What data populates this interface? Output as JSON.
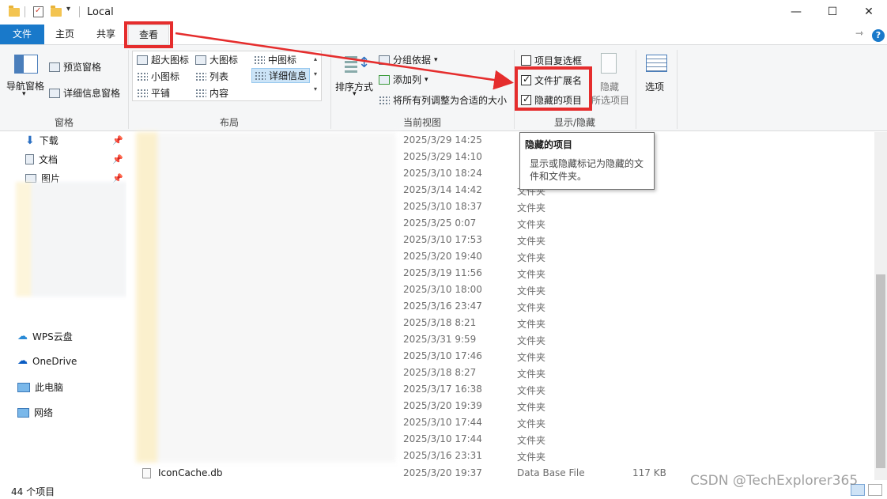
{
  "window": {
    "title": "Local"
  },
  "tabs": {
    "file": "文件",
    "home": "主页",
    "share": "共享",
    "view": "查看"
  },
  "ribbon": {
    "panes": {
      "nav": "导航窗格",
      "preview": "预览窗格",
      "details": "详细信息窗格",
      "group": "窗格"
    },
    "layout": {
      "xl": "超大图标",
      "large": "大图标",
      "medium": "中图标",
      "small": "小图标",
      "list": "列表",
      "details": "详细信息",
      "tiles": "平铺",
      "content": "内容",
      "group": "布局"
    },
    "current_view": {
      "sort": "排序方式",
      "group_by": "分组依据",
      "add_col": "添加列",
      "fit_cols": "将所有列调整为合适的大小",
      "group": "当前视图"
    },
    "show_hide": {
      "item_checkbox": "项目复选框",
      "file_ext": "文件扩展名",
      "hidden_items": "隐藏的项目",
      "hide_line1": "隐藏",
      "hide_line2": "所选项目",
      "group": "显示/隐藏"
    },
    "options": "选项",
    "checkboxes": {
      "item_checkbox": false,
      "file_ext": true,
      "hidden_items": true
    }
  },
  "tooltip": {
    "title": "隐藏的项目",
    "text": "显示或隐藏标记为隐藏的文件和文件夹。"
  },
  "navpane": {
    "downloads": "下载",
    "docs": "文档",
    "pictures": "图片",
    "wps": "WPS云盘",
    "onedrive": "OneDrive",
    "pc": "此电脑",
    "network": "网络"
  },
  "files": [
    {
      "date": "2025/3/29 14:25",
      "type": ""
    },
    {
      "date": "2025/3/29 14:10",
      "type": ""
    },
    {
      "date": "2025/3/10 18:24",
      "type": ""
    },
    {
      "date": "2025/3/14 14:42",
      "type": "文件夹"
    },
    {
      "date": "2025/3/10 18:37",
      "type": "文件夹"
    },
    {
      "date": "2025/3/25 0:07",
      "type": "文件夹"
    },
    {
      "date": "2025/3/10 17:53",
      "type": "文件夹"
    },
    {
      "date": "2025/3/20 19:40",
      "type": "文件夹"
    },
    {
      "date": "2025/3/19 11:56",
      "type": "文件夹"
    },
    {
      "date": "2025/3/10 18:00",
      "type": "文件夹"
    },
    {
      "date": "2025/3/16 23:47",
      "type": "文件夹"
    },
    {
      "date": "2025/3/18 8:21",
      "type": "文件夹"
    },
    {
      "date": "2025/3/31 9:59",
      "type": "文件夹"
    },
    {
      "date": "2025/3/10 17:46",
      "type": "文件夹"
    },
    {
      "date": "2025/3/18 8:27",
      "type": "文件夹"
    },
    {
      "date": "2025/3/17 16:38",
      "type": "文件夹"
    },
    {
      "date": "2025/3/20 19:39",
      "type": "文件夹"
    },
    {
      "date": "2025/3/10 17:44",
      "type": "文件夹"
    },
    {
      "date": "2025/3/10 17:44",
      "type": "文件夹"
    },
    {
      "date": "2025/3/16 23:31",
      "type": "文件夹"
    }
  ],
  "last_file": {
    "name": "IconCache.db",
    "date": "2025/3/20 19:37",
    "type": "Data Base File",
    "size": "117 KB"
  },
  "status": {
    "count": "44 个项目"
  },
  "watermark": "CSDN @TechExplorer365",
  "colors": {
    "accent": "#1979ca",
    "annotation": "#e52d2d"
  }
}
